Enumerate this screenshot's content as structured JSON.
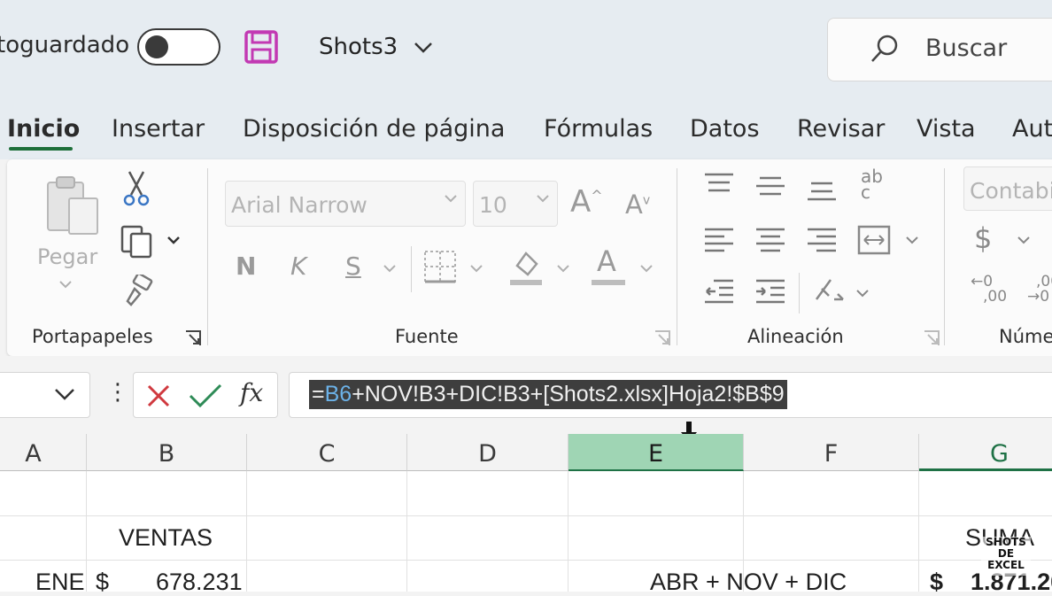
{
  "titlebar": {
    "autosave_label": "toguardado",
    "filename": "Shots3",
    "search_placeholder": "Buscar"
  },
  "tabs": [
    "Inicio",
    "Insertar",
    "Disposición de página",
    "Fórmulas",
    "Datos",
    "Revisar",
    "Vista",
    "Aut"
  ],
  "active_tab": "Inicio",
  "ribbon": {
    "clipboard": {
      "paste_label": "Pegar",
      "group_label": "Portapapeles"
    },
    "font": {
      "font_name": "Arial Narrow",
      "font_size": "10",
      "bold": "N",
      "italic": "K",
      "underline": "S",
      "grow": "A",
      "shrink": "A",
      "font_color": "A",
      "group_label": "Fuente"
    },
    "alignment": {
      "wrap_glyph": "ab",
      "wrap_glyph2": "c",
      "group_label": "Alineación"
    },
    "number": {
      "format": "Contabi",
      "currency": "$",
      "inc_top": "0",
      "inc_bottom": ",00",
      "dec_top": ",00",
      "dec_bottom": "0",
      "group_label": "Núme"
    }
  },
  "formula_bar": {
    "fx": "fx",
    "formula_eq": "=",
    "formula_ref": "B6",
    "formula_rest": "+NOV!B3+DIC!B3+[Shots2.xlsx]Hoja2!$B$9"
  },
  "grid": {
    "columns": [
      "A",
      "B",
      "C",
      "D",
      "E",
      "F",
      "G"
    ],
    "selected_column": "E",
    "cells": {
      "b_header": "VENTAS",
      "g_header": "SUMA",
      "a_row": "ENE",
      "b_currency": "$",
      "b_value": "678.231",
      "e_text": "ABR + NOV + DIC",
      "g_currency": "$",
      "g_value": "1.871.20"
    }
  },
  "watermark": {
    "line1": "SHOTS",
    "line2": "DE EXCEL"
  },
  "colors": {
    "accent_green": "#1e7145",
    "selected_header": "#9fd5b4",
    "save_icon": "#c239b3"
  }
}
